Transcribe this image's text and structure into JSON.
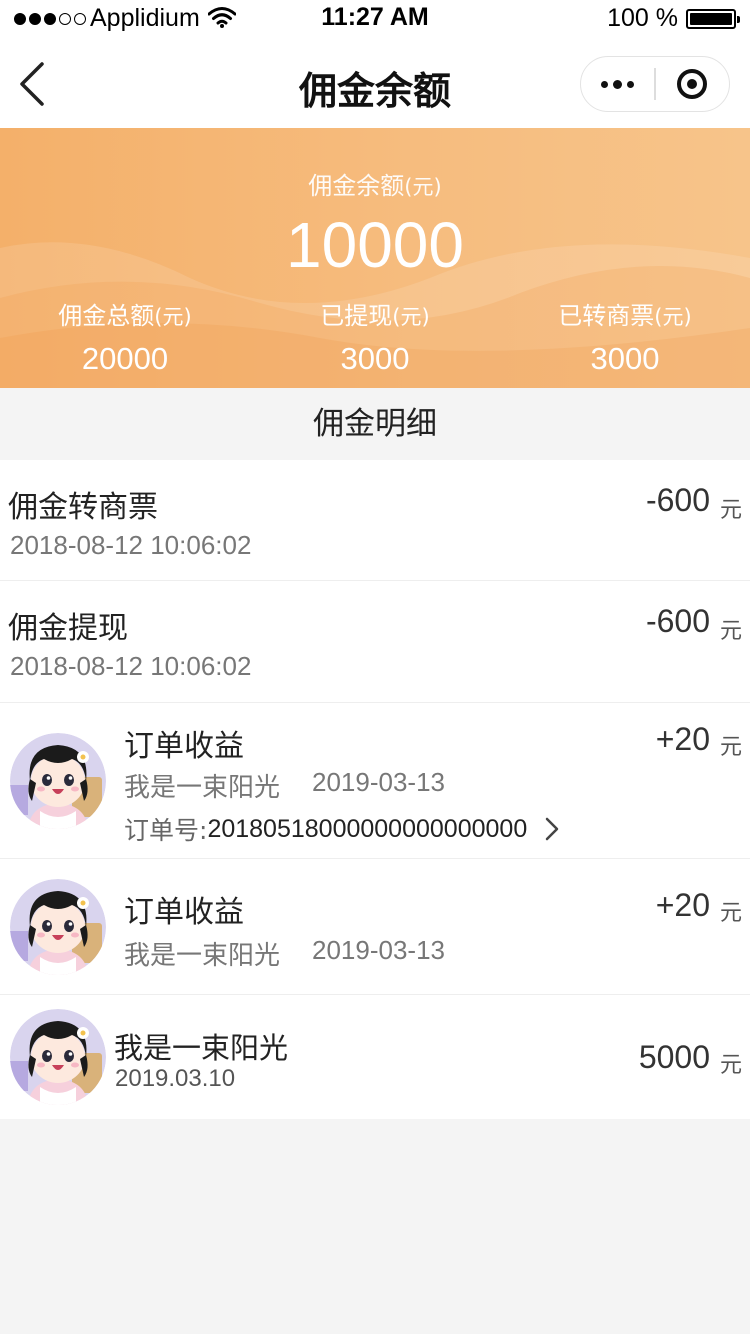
{
  "status_bar": {
    "carrier": "Applidium",
    "time": "11:27 AM",
    "battery": "100 %"
  },
  "nav": {
    "title": "佣金余额"
  },
  "summary": {
    "balance_label": "佣金余额",
    "balance_unit": "(元)",
    "balance_value": "10000",
    "stats": [
      {
        "label": "佣金总额",
        "unit": "(元)",
        "value": "20000"
      },
      {
        "label": "已提现",
        "unit": "(元)",
        "value": "3000"
      },
      {
        "label": "已转商票",
        "unit": "(元)",
        "value": "3000"
      }
    ]
  },
  "detail": {
    "section_title": "佣金明细",
    "currency_unit": "元",
    "records": [
      {
        "title": "佣金转商票",
        "datetime": "2018-08-12 10:06:02",
        "amount": "-600"
      },
      {
        "title": "佣金提现",
        "datetime": "2018-08-12 10:06:02",
        "amount": "-600"
      },
      {
        "title": "订单收益",
        "name": "我是一束阳光",
        "date": "2019-03-13",
        "amount": "+20",
        "order_label": "订单号:",
        "order_no": "20180518000000000000000"
      },
      {
        "title": "订单收益",
        "name": "我是一束阳光",
        "date": "2019-03-13",
        "amount": "+20"
      },
      {
        "name": "我是一束阳光",
        "date": "2019.03.10",
        "amount": "5000"
      }
    ]
  },
  "icons": {
    "back": "chevron-left-icon",
    "more": "more-dots-icon",
    "close": "target-close-icon",
    "order_arrow": "chevron-right-icon",
    "avatar": "cartoon-girl-avatar"
  },
  "colors": {
    "banner_start": "#f4b06a",
    "banner_end": "#f7c48a",
    "background": "#f4f4f4"
  }
}
